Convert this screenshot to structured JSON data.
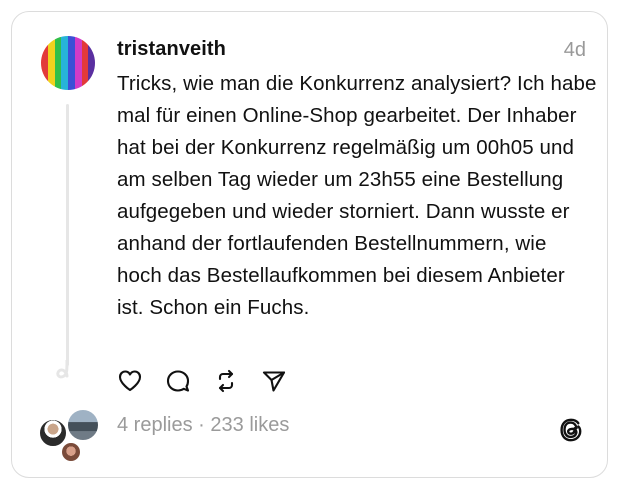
{
  "post": {
    "username": "tristanveith",
    "time": "4d",
    "text": "Tricks, wie man die Konkurrenz analysiert? Ich habe mal für einen Online-Shop gearbeitet. Der Inhaber hat bei der Konkurrenz regelmäßig um 00h05 und am selben Tag wieder um 23h55 eine Bestellung aufgegeben und wieder storniert. Dann wusste er anhand der fortlaufenden Bestellnummern, wie hoch das Bestellaufkommen bei diesem Anbieter ist. Schon ein Fuchs.",
    "avatar_colors": [
      "#e23a3a",
      "#f0d21e",
      "#2fbf4a",
      "#27b4d8",
      "#3c4fd6",
      "#d23bc7",
      "#e23a3a",
      "#5a2fa0"
    ]
  },
  "actions": [
    {
      "name": "like-button",
      "icon": "heart-icon"
    },
    {
      "name": "reply-button",
      "icon": "comment-icon"
    },
    {
      "name": "repost-button",
      "icon": "repost-icon"
    },
    {
      "name": "share-button",
      "icon": "send-icon"
    }
  ],
  "stats": {
    "replies": "4 replies",
    "separator": " · ",
    "likes": "233 likes"
  },
  "colors": {
    "text": "#111111",
    "muted": "#999999",
    "border": "#dcdcdc"
  }
}
